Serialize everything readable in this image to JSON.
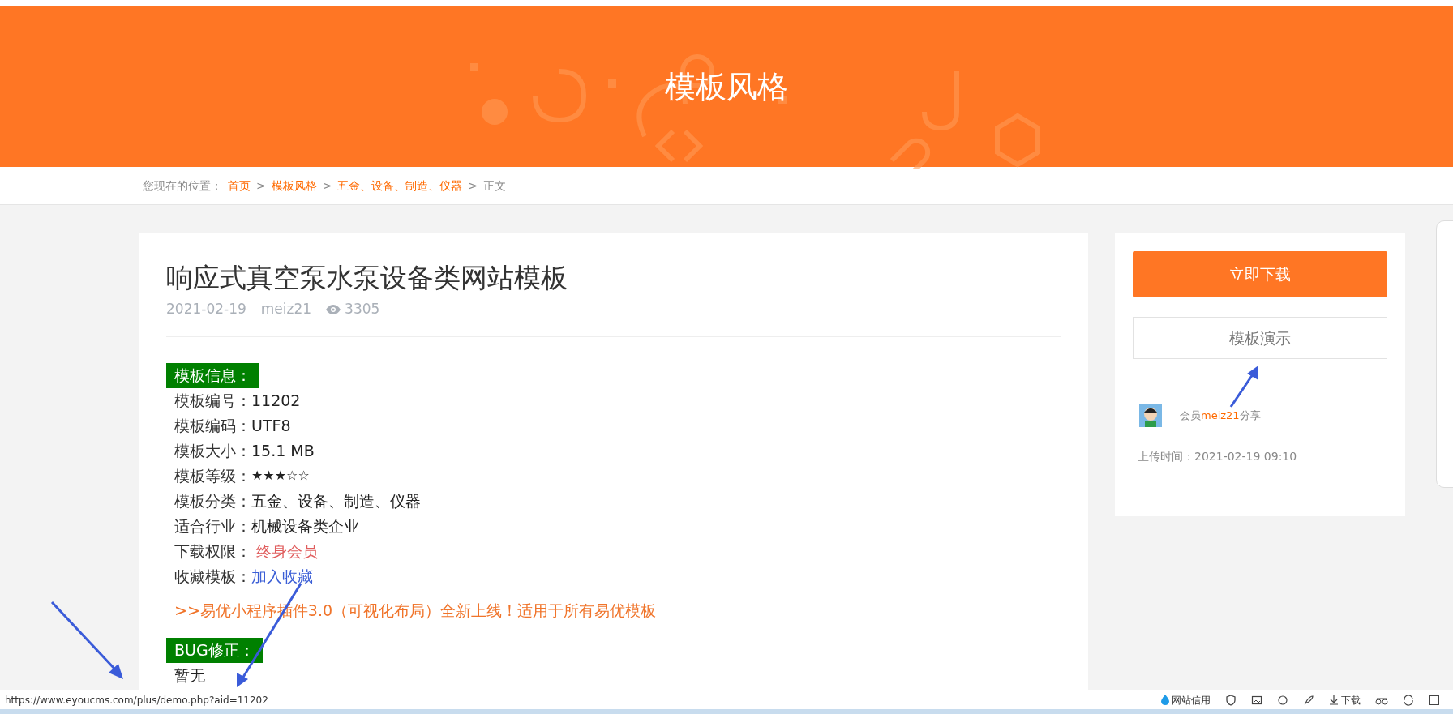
{
  "banner": {
    "title": "模板风格"
  },
  "breadcrumb": {
    "prefix": "您现在的位置：",
    "links": [
      "首页",
      "模板风格",
      "五金、设备、制造、仪器"
    ],
    "separator": ">",
    "current": "正文"
  },
  "article": {
    "title": "响应式真空泵水泵设备类网站模板",
    "date": "2021-02-19",
    "author": "meiz21",
    "views": "3305",
    "sections": [
      {
        "heading": "模板信息：",
        "rows": [
          {
            "kind": "text",
            "label": "模板编号：",
            "value": "11202"
          },
          {
            "kind": "text",
            "label": "模板编码：",
            "value": "UTF8"
          },
          {
            "kind": "text",
            "label": "模板大小：",
            "value": "15.1 MB"
          },
          {
            "kind": "stars",
            "label": "模板等级：",
            "stars": 3
          },
          {
            "kind": "text",
            "label": "模板分类：",
            "value": "五金、设备、制造、仪器"
          },
          {
            "kind": "text",
            "label": "适合行业：",
            "value": "机械设备类企业"
          },
          {
            "kind": "member",
            "label": "下载权限：",
            "value": "终身会员"
          },
          {
            "kind": "link",
            "label": "收藏模板：",
            "value": "加入收藏"
          }
        ],
        "promo": ">>易优小程序插件3.0（可视化布局）全新上线！适用于所有易优模板"
      },
      {
        "heading": "BUG修正：",
        "text": "暂无"
      }
    ]
  },
  "sidebar": {
    "download_button": "立即下载",
    "demo_button": "模板演示",
    "share_prefix": "会员",
    "share_user": "meiz21",
    "share_suffix": "分享",
    "upload_time": "上传时间：2021-02-19 09:10"
  },
  "status_bar": {
    "url": "https://www.eyoucms.com/plus/demo.php?aid=11202",
    "credit": "网站信用",
    "download": "下载"
  }
}
